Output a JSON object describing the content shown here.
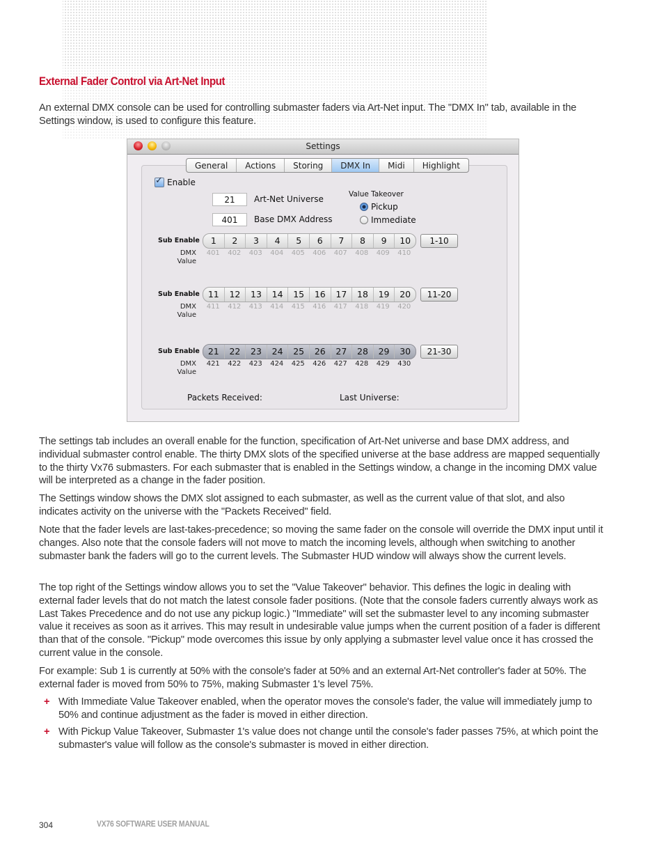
{
  "section": {
    "heading": "External Fader Control via Art-Net Input",
    "intro": "An external DMX console can be used for controlling submaster faders via Art-Net input. The \"DMX In\" tab, available in the Settings window, is used to configure this feature."
  },
  "settings_window": {
    "title": "Settings",
    "tabs": [
      {
        "label": "General",
        "active": false
      },
      {
        "label": "Actions",
        "active": false
      },
      {
        "label": "Storing",
        "active": false
      },
      {
        "label": "DMX In",
        "active": true
      },
      {
        "label": "Midi",
        "active": false
      },
      {
        "label": "Highlight",
        "active": false
      }
    ],
    "enable_label": "Enable",
    "enable_checked": true,
    "artnet_universe": {
      "value": "21",
      "label": "Art-Net Universe"
    },
    "base_dmx_address": {
      "value": "401",
      "label": "Base DMX Address"
    },
    "value_takeover": {
      "label": "Value Takeover",
      "options": [
        {
          "label": "Pickup",
          "selected": true
        },
        {
          "label": "Immediate",
          "selected": false
        }
      ]
    },
    "sub_enable_label": "Sub Enable",
    "dmx_label": "DMX",
    "value_label": "Value",
    "banks": [
      {
        "range_button": "1-10",
        "enabled": false,
        "subs": [
          "1",
          "2",
          "3",
          "4",
          "5",
          "6",
          "7",
          "8",
          "9",
          "10"
        ],
        "dmx": [
          "401",
          "402",
          "403",
          "404",
          "405",
          "406",
          "407",
          "408",
          "409",
          "410"
        ]
      },
      {
        "range_button": "11-20",
        "enabled": false,
        "subs": [
          "11",
          "12",
          "13",
          "14",
          "15",
          "16",
          "17",
          "18",
          "19",
          "20"
        ],
        "dmx": [
          "411",
          "412",
          "413",
          "414",
          "415",
          "416",
          "417",
          "418",
          "419",
          "420"
        ]
      },
      {
        "range_button": "21-30",
        "enabled": true,
        "subs": [
          "21",
          "22",
          "23",
          "24",
          "25",
          "26",
          "27",
          "28",
          "29",
          "30"
        ],
        "dmx": [
          "421",
          "422",
          "423",
          "424",
          "425",
          "426",
          "427",
          "428",
          "429",
          "430"
        ]
      }
    ],
    "packets_received_label": "Packets Received:",
    "last_universe_label": "Last Universe:"
  },
  "body": {
    "p1": "The settings tab includes an overall enable for the function, specification of Art-Net universe and base DMX address, and individual submaster control enable. The thirty DMX slots of the specified universe at the base address are mapped sequentially to the thirty Vx76 submasters. For each submaster that is enabled in the Settings window, a change in the incoming DMX value will be interpreted as a change in the fader position.",
    "p2": "The Settings window shows the DMX slot assigned to each submaster, as well as the current value of that slot, and also indicates activity on the universe with the \"Packets Received\" field.",
    "p3": "Note that the fader levels are last-takes-precedence; so moving the same fader on the console will override the DMX input until it changes. Also note that the console faders will not move to match the incoming levels, although when switching to another submaster bank the faders will go to the current levels. The Submaster HUD window will always show the current levels.",
    "p4": "The top right of the Settings window allows you to set the \"Value Takeover\" behavior. This defines the logic in dealing with external fader levels that do not match the latest console fader positions. (Note that the console faders currently always work as Last Takes Precedence and do not use any pickup logic.) \"Immediate\" will set the submaster level to any incoming submaster value it receives as soon as it arrives. This may result in undesirable value jumps when the current position of a fader is different than that of the console. \"Pickup\" mode overcomes this issue by only applying a submaster level value once it has crossed the current value in the console.",
    "p5": "For example: Sub 1 is currently at 50% with the console's fader at 50% and an external Art-Net controller's fader at 50%. The external fader is moved from 50% to 75%, making Submaster 1's level 75%.",
    "bullet_marker": "+",
    "bullets": [
      "With Immediate Value Takeover enabled, when the operator moves the console's fader, the value will immediately jump to 50% and continue adjustment as the fader is moved in either direction.",
      "With Pickup Value Takeover, Submaster 1's value does not change until the console's fader passes 75%, at which point the submaster's value will follow as the console's submaster is moved in either direction."
    ]
  },
  "footer": {
    "page_number": "304",
    "manual_title": "VX76 SOFTWARE USER MANUAL"
  }
}
